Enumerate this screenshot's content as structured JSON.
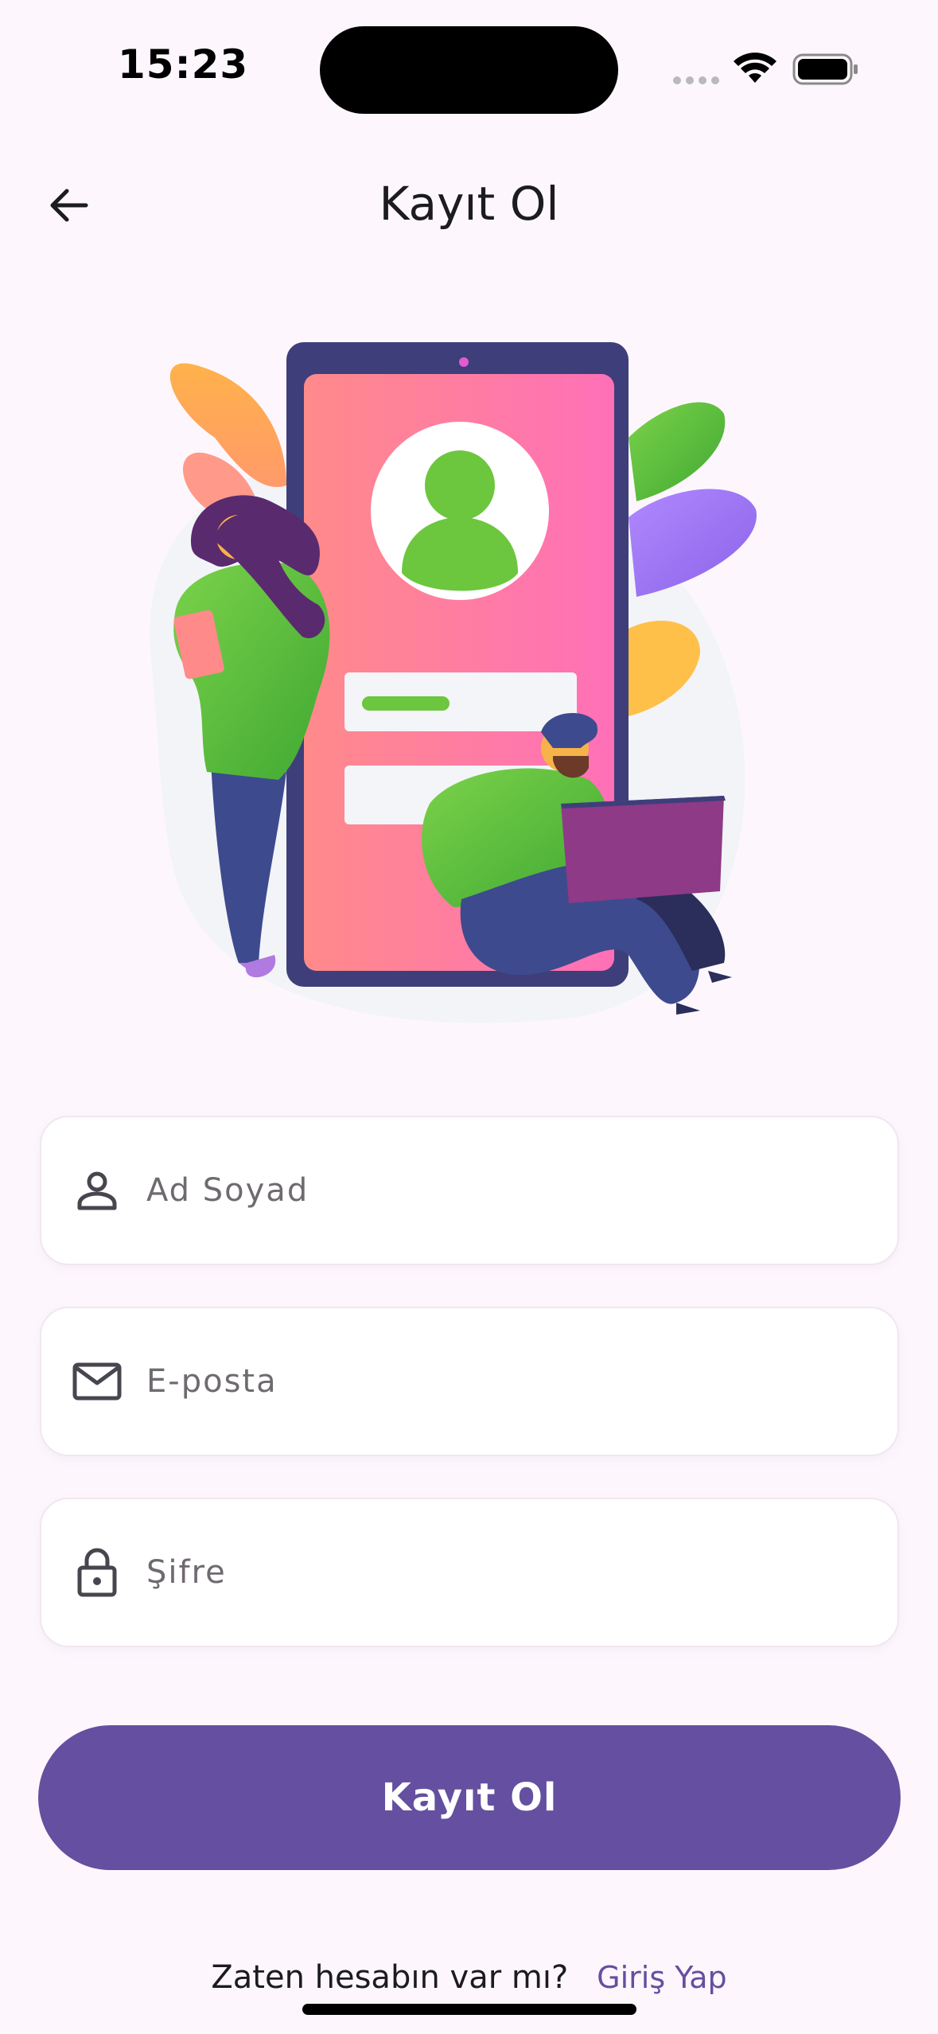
{
  "status_bar": {
    "time": "15:23",
    "icons": [
      "cellular-dots-icon",
      "wifi-icon",
      "battery-icon"
    ]
  },
  "header": {
    "title": "Kayıt Ol",
    "back_icon": "arrow-left-icon"
  },
  "illustration": {
    "description_icon": "signup-illustration"
  },
  "form": {
    "name": {
      "placeholder": "Ad Soyad",
      "value": "",
      "icon": "person-icon"
    },
    "email": {
      "placeholder": "E-posta",
      "value": "",
      "icon": "mail-icon"
    },
    "password": {
      "placeholder": "Şifre",
      "value": "",
      "icon": "lock-icon"
    }
  },
  "primary_button": {
    "label": "Kayıt Ol"
  },
  "footer": {
    "prompt": "Zaten hesabın var mı?",
    "link": "Giriş Yap"
  },
  "colors": {
    "background": "#fdf7fd",
    "accent": "#654fa0",
    "field_bg": "#ffffff",
    "text": "#1c1b1f",
    "placeholder": "#6f6a70"
  }
}
